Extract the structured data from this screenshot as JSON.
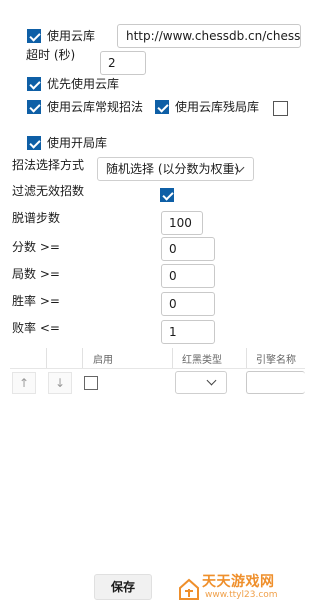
{
  "cloud": {
    "use_cloud_label": "使用云库",
    "use_cloud_checked": true,
    "url_value": "http://www.chessdb.cn/chessdb.",
    "timeout_label": "超时 (秒)",
    "timeout_value": "2",
    "prefer_cloud_label": "优先使用云库",
    "prefer_cloud_checked": true,
    "normal_moves_label": "使用云库常规招法",
    "normal_moves_checked": true,
    "endgame_label": "使用云库残局库",
    "endgame_checked": true,
    "extra_checked": false
  },
  "opening": {
    "use_opening_label": "使用开局库",
    "use_opening_checked": true,
    "method_label": "招法选择方式",
    "method_value": "随机选择 (以分数为权重)",
    "filter_label": "过滤无效招数",
    "filter_checked": true,
    "leave_steps_label": "脱谱步数",
    "leave_steps_value": "100",
    "score_label": "分数 >=",
    "score_value": "0",
    "games_label": "局数 >=",
    "games_value": "0",
    "win_label": "胜率 >=",
    "win_value": "0",
    "loss_label": "败率 <=",
    "loss_value": "1"
  },
  "grid": {
    "col_enabled": "启用",
    "col_side_type": "红黑类型",
    "col_engine_name": "引擎名称",
    "up_arrow": "↑",
    "down_arrow": "↓",
    "row_enabled_checked": false
  },
  "footer": {
    "save_label": "保存"
  },
  "watermark": {
    "title": "天天游戏网",
    "url": "www.ttyl23.com"
  },
  "colors": {
    "accent": "#0e5fa6",
    "watermark": "#ef8f2b"
  }
}
